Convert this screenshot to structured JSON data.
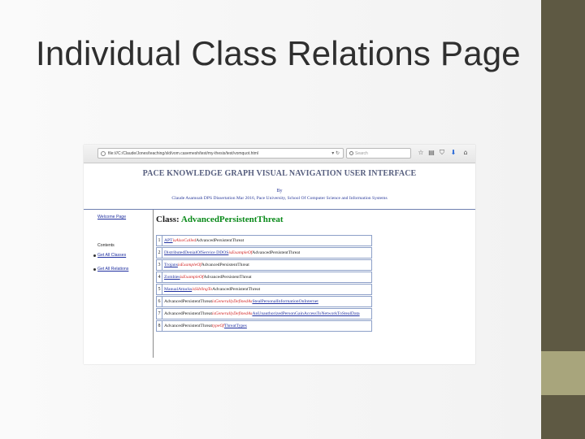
{
  "slide": {
    "title": "Individual Class Relations Page"
  },
  "browser": {
    "url": "file:///C:/Claude/Jones/teaching/sld/vom.casemesh/test/my-thesis/test/vomquot.html",
    "search_placeholder": "Search"
  },
  "page": {
    "title": "PACE KNOWLEDGE GRAPH VISUAL NAVIGATION USER INTERFACE",
    "by": "By",
    "subtitle": "Claude Asamoah DPS Dissertation Mar 2016, Pace University, School Of Computer Science and Information Systems"
  },
  "nav": {
    "welcome": "Welcome Page",
    "contents": "Contents",
    "get_all_classes": "Get All Classes",
    "get_all_relations": "Get All Relations"
  },
  "class": {
    "prefix": "Class: ",
    "name": "AdvancedPersistentThreat"
  },
  "relations": [
    {
      "num": "1",
      "subject": "APT",
      "predicate": "isAlsoCalled",
      "object": "AdvancedPersistentThreat",
      "object_link": ""
    },
    {
      "num": "2",
      "subject": "DistributedDenialOfService DDOS",
      "predicate": "isExampleOf",
      "object": "AdvancedPersistentThreat",
      "object_link": ""
    },
    {
      "num": "3",
      "subject": "Trojans",
      "predicate": "isExampleOf",
      "object": "AdvancedPersistentThreat",
      "object_link": ""
    },
    {
      "num": "4",
      "subject": "Zombies",
      "predicate": "isExampleOf",
      "object": "AdvancedPersistentThreat",
      "object_link": ""
    },
    {
      "num": "5",
      "subject": "ManualAttacks",
      "predicate": "isSiblingTo",
      "object": "AdvancedPersistentThreat",
      "object_link": ""
    },
    {
      "num": "6",
      "subject": "AdvancedPersistentThreat",
      "predicate": "isGenerallyDefinedAs",
      "object": "",
      "object_link": "StealPersonalInformationOnInternet"
    },
    {
      "num": "7",
      "subject": "AdvancedPersistentThreat",
      "predicate": "isGenerallyDefinedAs",
      "object": "",
      "object_link": "AnUnauthorizedPersonGainAccessToNetworkToStealData"
    },
    {
      "num": "8",
      "subject": "AdvancedPersistentThreat",
      "predicate": "typeOf",
      "object": "",
      "object_link": "ThreatTypes"
    }
  ],
  "colors": {
    "band_dark": "#5e5943",
    "band_light": "#a8a57c",
    "class_name": "#0a8a1a",
    "link": "#2030a0",
    "predicate": "#d02020"
  }
}
